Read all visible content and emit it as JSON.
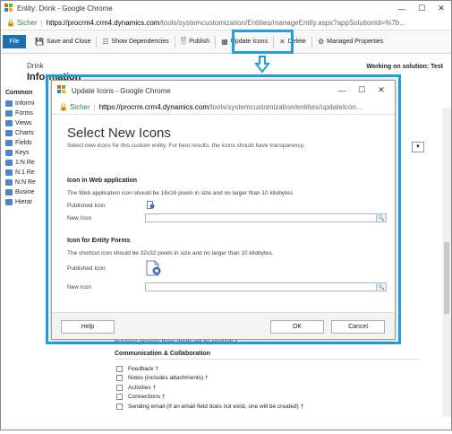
{
  "outer_window": {
    "title": "Entity: Drink - Google Chrome",
    "secure_label": "Sicher",
    "url_host": "https://procrm4.crm4.dynamics.com",
    "url_path": "/tools/systemcustomization/Entities/manageEntity.aspx?appSolutionId=%7b..."
  },
  "ribbon": {
    "file": "File",
    "save_close": "Save and Close",
    "show_dependencies": "Show Dependencies",
    "publish": "Publish",
    "update_icons": "Update Icons",
    "delete": "Delete",
    "managed_properties": "Managed Properties"
  },
  "entity": {
    "name": "Drink",
    "section": "Information",
    "working_on": "Working on solution: Test"
  },
  "leftnav": {
    "header": "Common",
    "items": [
      "Informi",
      "Forms",
      "Views",
      "Charts",
      "Fields",
      "Keys",
      "1:N Re",
      "N:1 Re",
      "N:N Re",
      "Busine",
      "Hierar"
    ]
  },
  "background": {
    "bpf": "Business process flows (fields will be created) †",
    "section": "Communication & Collaboration",
    "checkboxes": [
      "Feedback †",
      "Notes (includes attachments) †",
      "Activities †",
      "Connections †",
      "Sending email (If an email field does not exist, one will be created) †"
    ]
  },
  "dialog": {
    "title": "Update Icons - Google Chrome",
    "secure_label": "Sicher",
    "url_host": "https://procrm.crm4.dynamics.com",
    "url_path": "/tools/systemcustomization/entities/updateIcon...",
    "heading": "Select New Icons",
    "subtitle": "Select new icons for this custom entity. For best results, the icons should have transparency.",
    "web_section": "Icon in Web application",
    "web_desc": "The Web application icon should be 16x16 pixels in size and no larger than 10 kilobytes.",
    "published_icon": "Published Icon",
    "new_icon": "New Icon",
    "forms_section": "Icon for Entity Forms",
    "forms_desc": "The shortcut icon should be 32x32 pixels in size and no larger than 10 kilobytes.",
    "help": "Help",
    "ok": "OK",
    "cancel": "Cancel"
  },
  "colors": {
    "highlight": "#1ea1dc",
    "file_button": "#1b6fb4",
    "secure_green": "#2e7d32"
  }
}
